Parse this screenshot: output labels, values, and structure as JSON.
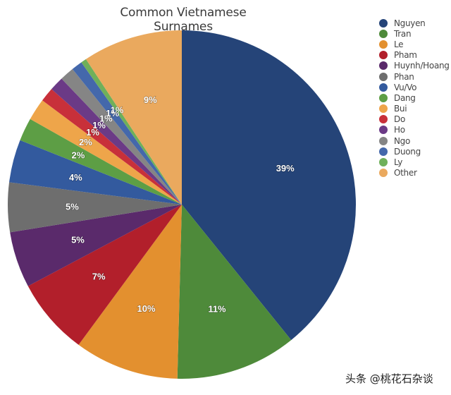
{
  "chart_data": {
    "type": "pie",
    "title": "Common Vietnamese Surnames",
    "start": "12 o'clock, clockwise",
    "legend_position": "right",
    "slices": [
      {
        "name": "Nguyen",
        "value": 38.4,
        "label": "39%",
        "color": "#254478"
      },
      {
        "name": "Tran",
        "value": 11.0,
        "label": "11%",
        "color": "#4e8a3a"
      },
      {
        "name": "Le",
        "value": 9.5,
        "label": "10%",
        "color": "#e3902f"
      },
      {
        "name": "Pham",
        "value": 7.0,
        "label": "7%",
        "color": "#b21f2b"
      },
      {
        "name": "Huynh/Hoang",
        "value": 5.1,
        "label": "5%",
        "color": "#5a2a6b"
      },
      {
        "name": "Phan",
        "value": 4.5,
        "label": "5%",
        "color": "#6e6e6e"
      },
      {
        "name": "Vu/Vo",
        "value": 3.9,
        "label": "4%",
        "color": "#335a9e"
      },
      {
        "name": "Dang",
        "value": 2.1,
        "label": "2%",
        "color": "#5d9e45"
      },
      {
        "name": "Bui",
        "value": 2.0,
        "label": "2%",
        "color": "#eea54a"
      },
      {
        "name": "Do",
        "value": 1.3,
        "label": "1%",
        "color": "#c8303a"
      },
      {
        "name": "Ho",
        "value": 1.3,
        "label": "1%",
        "color": "#6b3a86"
      },
      {
        "name": "Ngo",
        "value": 1.3,
        "label": "1%",
        "color": "#858585"
      },
      {
        "name": "Duong",
        "value": 1.0,
        "label": "1%",
        "color": "#4468ab"
      },
      {
        "name": "Ly",
        "value": 0.5,
        "label": "1%",
        "color": "#6fb05a"
      },
      {
        "name": "Other",
        "value": 9.1,
        "label": "9%",
        "color": "#eaa95e"
      }
    ]
  },
  "watermark": "头条 @桃花石杂谈"
}
